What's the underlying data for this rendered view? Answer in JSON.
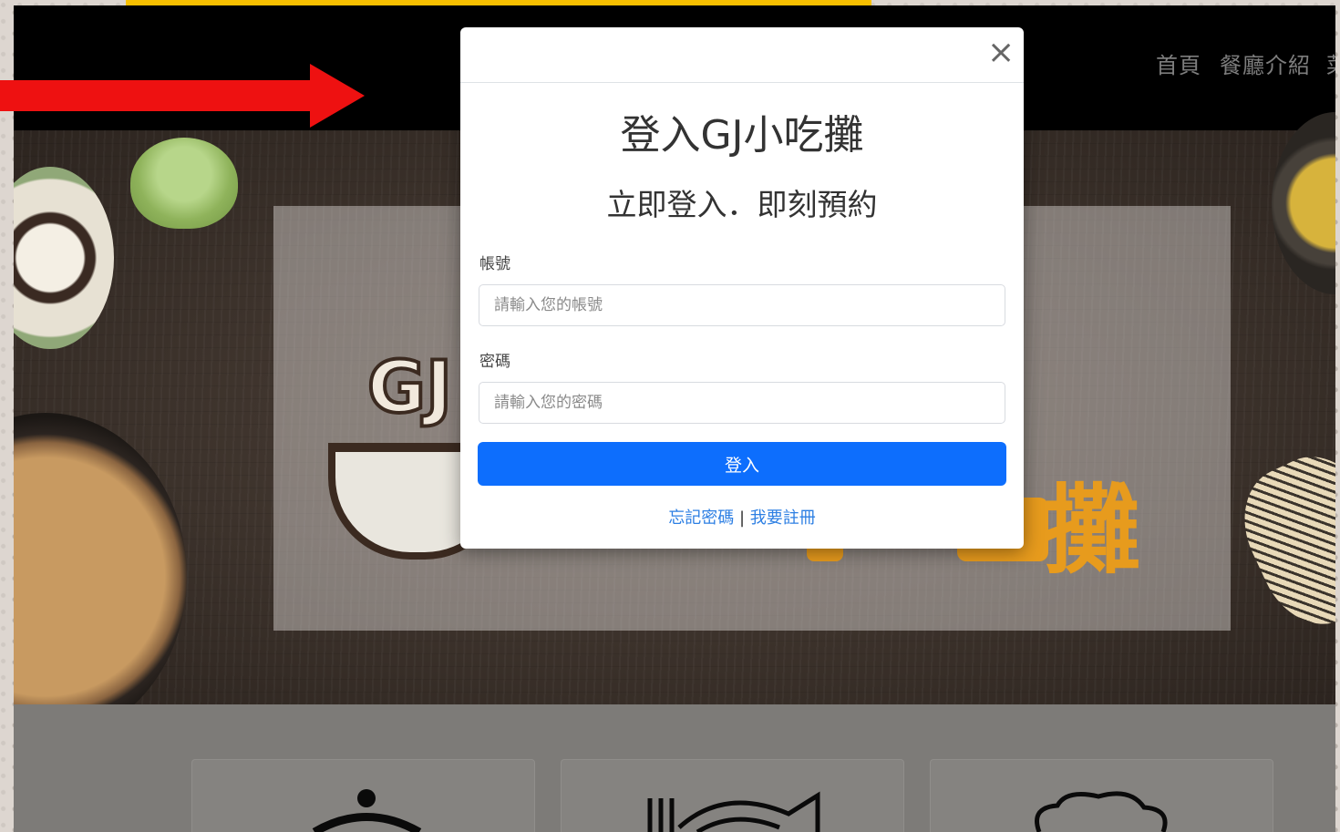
{
  "nav": {
    "home": "首頁",
    "intro": "餐廳介紹",
    "more": "菜"
  },
  "hero": {
    "logo_text": "GJ",
    "brand_text": "攤"
  },
  "modal": {
    "title": "登入GJ小吃攤",
    "subtitle": "立即登入．即刻預約",
    "close_symbol": "×",
    "account_label": "帳號",
    "account_placeholder": "請輸入您的帳號",
    "password_label": "密碼",
    "password_placeholder": "請輸入您的密碼",
    "login_button": "登入",
    "forgot_password": "忘記密碼",
    "separator": "|",
    "register": "我要註冊"
  },
  "features": {
    "icons": [
      "cloche-icon",
      "fork-fish-icon",
      "chef-hat-icon"
    ]
  },
  "colors": {
    "annotation_arrow": "#ee1111",
    "annotation_strip": "#f7c000",
    "primary_button": "#0d6efd",
    "link": "#2d7fe3",
    "brand_orange": "#e79b1d"
  }
}
